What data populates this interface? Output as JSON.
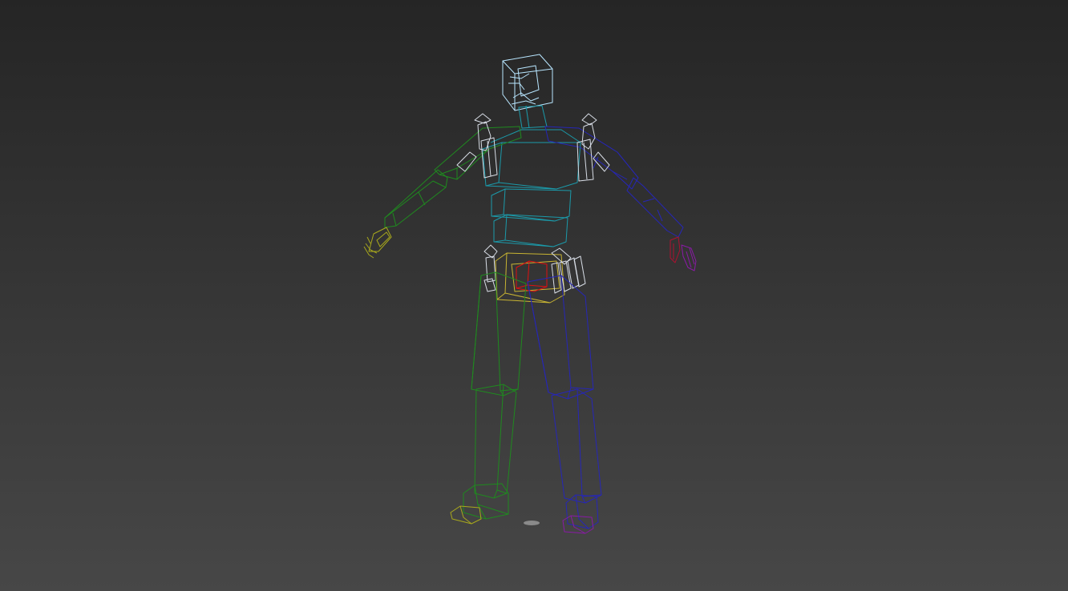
{
  "viewport": {
    "background_top": "#252525",
    "background_bottom": "#474747",
    "render_mode": "wireframe"
  },
  "rig": {
    "colors": {
      "head": "#b8e6ff",
      "spine": "#1b9aaa",
      "left_arm": "#1f8a1f",
      "right_arm": "#2626b8",
      "left_hand": "#a8a81c",
      "right_hand": "#b01030",
      "right_hand_fingers": "#8a1aa6",
      "pelvis": "#c8b432",
      "root": "#e01010",
      "left_leg": "#1f8a1f",
      "right_leg": "#2626b8",
      "left_foot": "#a8a81c",
      "right_foot": "#8a1aa6",
      "helper_bones": "#d8dde6",
      "ground_marker": "#8a8a8a"
    }
  }
}
